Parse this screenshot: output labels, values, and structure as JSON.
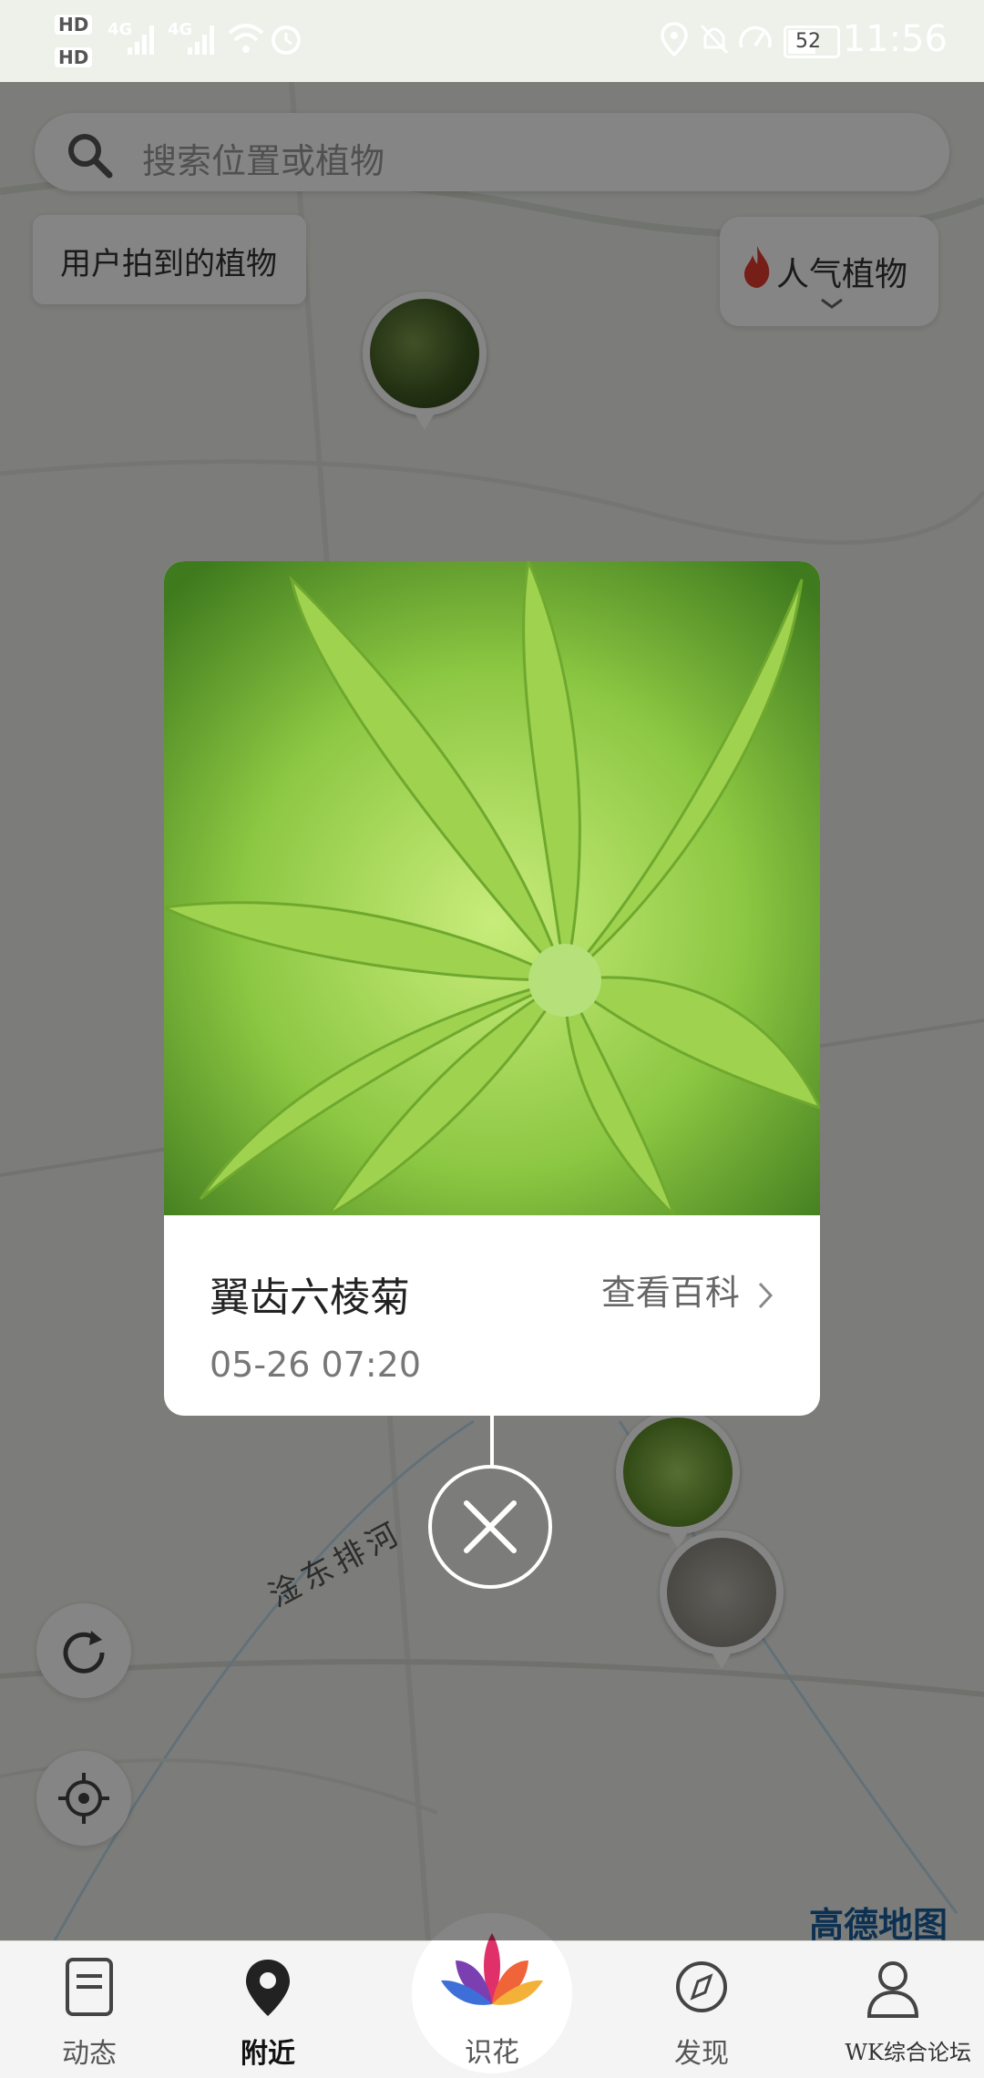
{
  "status_bar": {
    "hd1": "HD",
    "hd2": "HD",
    "net1": "4G",
    "net2": "4G",
    "battery": "52",
    "time": "11:56"
  },
  "search": {
    "placeholder": "搜索位置或植物"
  },
  "map_controls": {
    "user_plants_label": "用户拍到的植物",
    "popular_label": "人气植物"
  },
  "map_labels": {
    "river": "淦东排河",
    "provider_logo": "高德地图"
  },
  "plant_card": {
    "name": "翼齿六棱菊",
    "time": "05-26 07:20",
    "link_label": "查看百科"
  },
  "bottom_nav": {
    "items": [
      {
        "label": "动态",
        "icon": "feed-icon"
      },
      {
        "label": "附近",
        "icon": "location-pin-icon"
      },
      {
        "label": "识花",
        "icon": "lotus-icon"
      },
      {
        "label": "发现",
        "icon": "compass-icon"
      },
      {
        "label": "",
        "icon": "profile-icon"
      }
    ]
  },
  "watermark": "WK综合论坛",
  "colors": {
    "overlay": "rgba(0,0,0,0.48)",
    "accent_fire": "#e23b2e",
    "map_logo": "#1a5f9e"
  }
}
